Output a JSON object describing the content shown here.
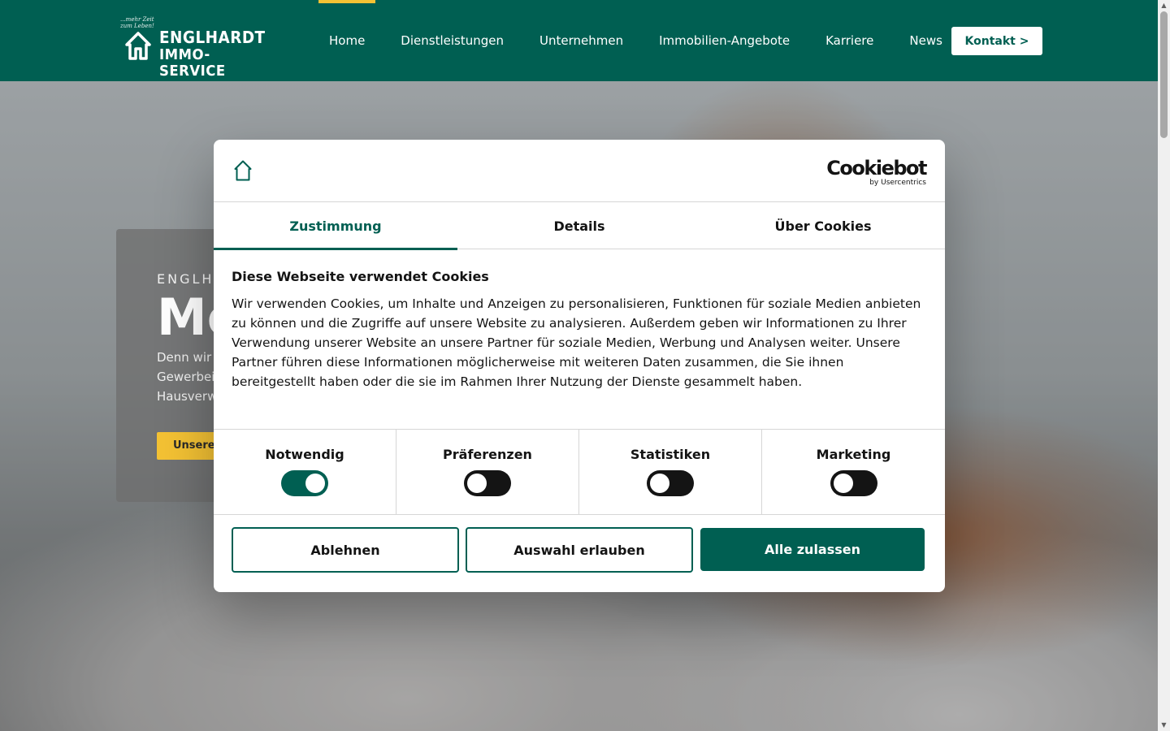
{
  "header": {
    "logo": {
      "tagline_line1": "...mehr Zeit",
      "tagline_line2": "zum Leben!",
      "name_line1": "ENGLHARDT",
      "name_line2": "IMMO-SERVICE"
    },
    "nav": [
      {
        "label": "Home",
        "active": true
      },
      {
        "label": "Dienstleistungen"
      },
      {
        "label": "Unternehmen"
      },
      {
        "label": "Immobilien-Angebote"
      },
      {
        "label": "Karriere"
      },
      {
        "label": "News"
      }
    ],
    "contact_label": "Kontakt >",
    "accent_color": "#005f52",
    "highlight_color": "#f4c234"
  },
  "hero": {
    "eyebrow": "ENGLH",
    "title": "Me",
    "text_line1": "Denn wir",
    "text_line2": "Gewerbei",
    "text_line3": "Hausverw",
    "button_label": "Unsere"
  },
  "cookie_dialog": {
    "provider_main": "Cookiebot",
    "provider_sub": "by Usercentrics",
    "tabs": [
      {
        "label": "Zustimmung",
        "active": true
      },
      {
        "label": "Details"
      },
      {
        "label": "Über Cookies"
      }
    ],
    "title": "Diese Webseite verwendet Cookies",
    "text": "Wir verwenden Cookies, um Inhalte und Anzeigen zu personalisieren, Funktionen für soziale Medien anbieten zu können und die Zugriffe auf unsere Website zu analysieren. Außerdem geben wir Informationen zu Ihrer Verwendung unserer Website an unsere Partner für soziale Medien, Werbung und Analysen weiter. Unsere Partner führen diese Informationen möglicherweise mit weiteren Daten zusammen, die Sie ihnen bereitgestellt haben oder die sie im Rahmen Ihrer Nutzung der Dienste gesammelt haben.",
    "toggles": [
      {
        "label": "Notwendig",
        "on": true
      },
      {
        "label": "Präferenzen",
        "on": false
      },
      {
        "label": "Statistiken",
        "on": false
      },
      {
        "label": "Marketing",
        "on": false
      }
    ],
    "buttons": {
      "decline": "Ablehnen",
      "allow_selection": "Auswahl erlauben",
      "allow_all": "Alle zulassen"
    }
  }
}
